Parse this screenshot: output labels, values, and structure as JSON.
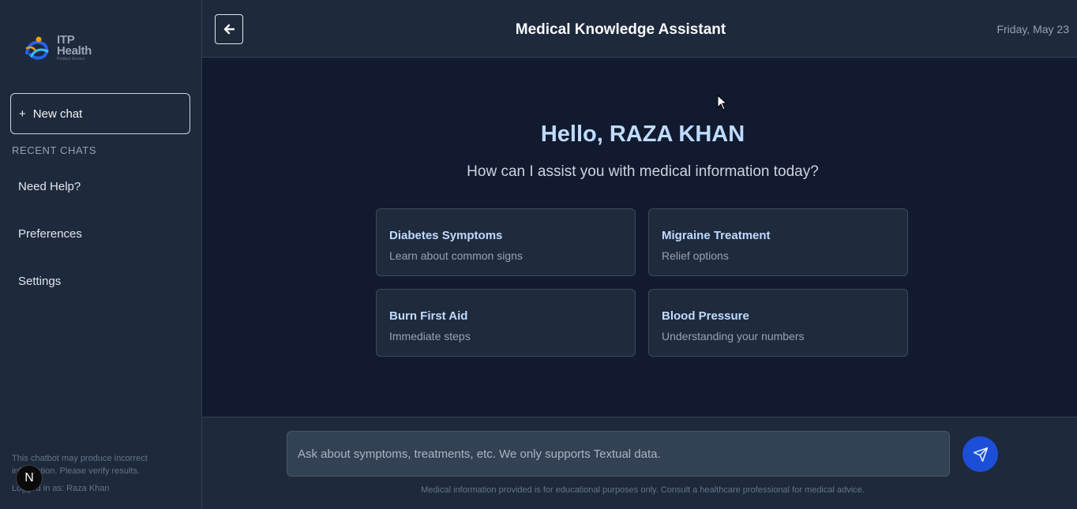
{
  "sidebar": {
    "logo": {
      "line1": "ITP",
      "line2": "Health",
      "tagline": "Product Service"
    },
    "new_chat_label": "New chat",
    "recent_title": "RECENT CHATS",
    "items": [
      {
        "label": "Need Help?"
      },
      {
        "label": "Preferences"
      },
      {
        "label": "Settings"
      }
    ],
    "disclaimer": "This chatbot may produce incorrect information. Please verify results.",
    "logged_in": "Logged in as: Raza Khan",
    "badge": "N"
  },
  "header": {
    "title": "Medical Knowledge Assistant",
    "date": "Friday, May 23"
  },
  "main": {
    "greeting": "Hello, RAZA KHAN",
    "subtitle": "How can I assist you with medical information today?",
    "cards": [
      {
        "title": "Diabetes Symptoms",
        "desc": "Learn about common signs"
      },
      {
        "title": "Migraine Treatment",
        "desc": "Relief options"
      },
      {
        "title": "Burn First Aid",
        "desc": "Immediate steps"
      },
      {
        "title": "Blood Pressure",
        "desc": "Understanding your numbers"
      }
    ]
  },
  "footer": {
    "placeholder": "Ask about symptoms, treatments, etc. We only supports Textual data.",
    "note": "Medical information provided is for educational purposes only. Consult a healthcare professional for medical advice."
  },
  "colors": {
    "accent": "#1d4ed8",
    "sidebar_bg": "#1e293b",
    "main_bg": "#111a2e",
    "heading": "#bfdbfe"
  }
}
